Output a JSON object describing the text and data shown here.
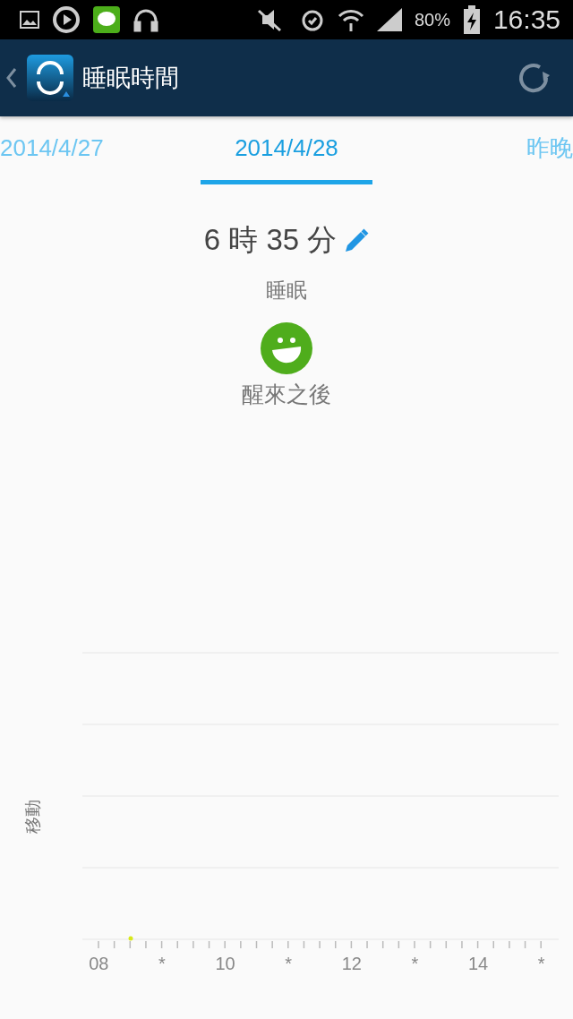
{
  "status_bar": {
    "battery": "80%",
    "time": "16:35"
  },
  "app_bar": {
    "title": "睡眠時間"
  },
  "tabs": [
    {
      "label": "2014/4/27",
      "selected": false
    },
    {
      "label": "2014/4/28",
      "selected": true
    },
    {
      "label": "昨晚",
      "selected": false
    }
  ],
  "summary": {
    "duration": "6 時 35 分",
    "label": "睡眠",
    "mood_label": "醒來之後"
  },
  "chart": {
    "ylabel": "移動",
    "xtick_labels": [
      "08",
      "*",
      "10",
      "*",
      "12",
      "*",
      "14",
      "*"
    ]
  }
}
